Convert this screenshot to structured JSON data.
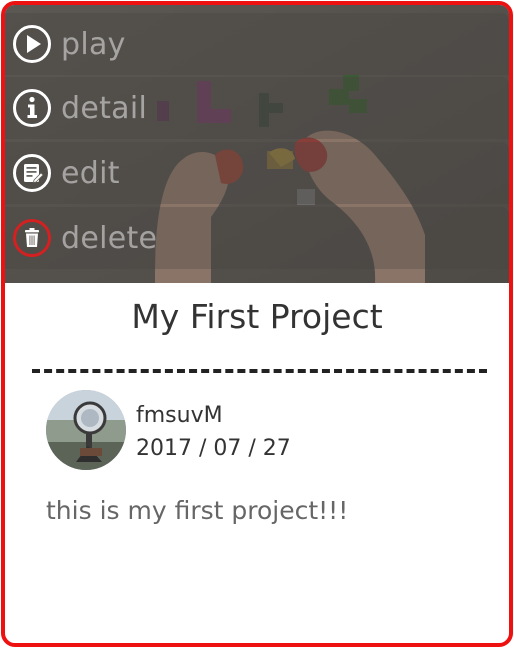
{
  "menu": {
    "play_label": "play",
    "detail_label": "detail",
    "edit_label": "edit",
    "delete_label": "delete"
  },
  "project": {
    "title": "My First Project",
    "author": "fmsuvM",
    "date": "2017 / 07 / 27",
    "description": "this is my first project!!!"
  },
  "icons": {
    "play": "play-circle-icon",
    "detail": "info-circle-icon",
    "edit": "edit-note-icon",
    "delete": "trash-icon"
  },
  "colors": {
    "card_border": "#ee1111",
    "delete_ring": "#d42020",
    "divider": "#222222",
    "title_text": "#333333",
    "description_text": "#666666"
  }
}
